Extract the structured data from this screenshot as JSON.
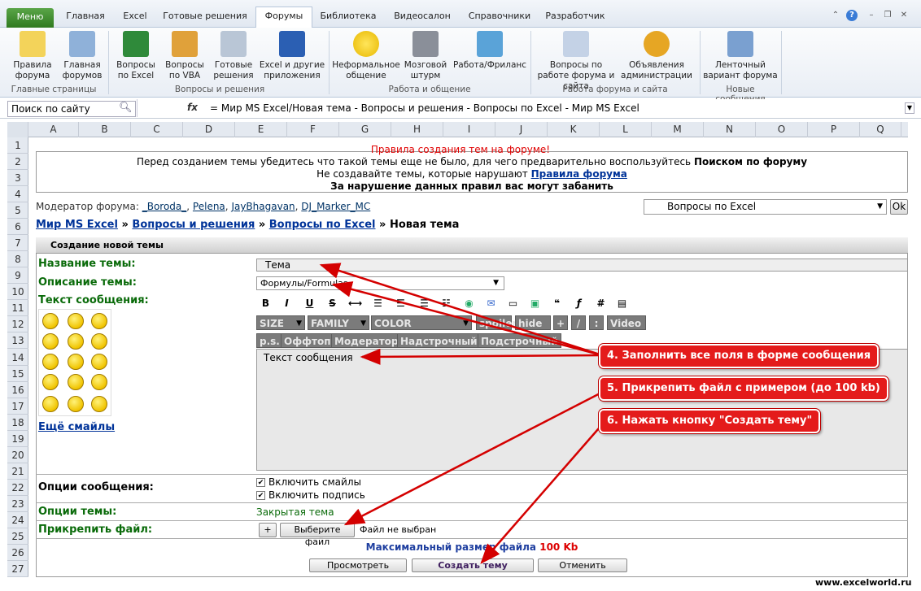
{
  "tabs": [
    "Меню",
    "Главная",
    "Excel",
    "Готовые решения",
    "Форумы",
    "Библиотека",
    "Видеосалон",
    "Справочники",
    "Разработчик"
  ],
  "ribbon": {
    "btn1": "Правила форума",
    "btn2": "Главная форумов",
    "grp1": "Главные страницы",
    "btn3": "Вопросы по Excel",
    "btn4": "Вопросы по VBA",
    "btn5": "Готовые решения",
    "btn6": "Excel и другие приложения",
    "grp2": "Вопросы и решения",
    "btn7": "Неформальное общение",
    "btn8": "Мозговой штурм",
    "btn9": "Работа/Фриланс",
    "grp3": "Работа и общение",
    "btn10": "Вопросы по работе форума и сайта",
    "btn11": "Объявления администрации",
    "grp4": "Работа форума и сайта",
    "btn12": "Ленточный вариант форума",
    "grp5": "Новые сообщения"
  },
  "formula_bar": {
    "namebox": "Поиск по сайту",
    "fx": "fx",
    "formula": "= Мир MS Excel/Новая тема - Вопросы и решения - Вопросы по Excel - Мир MS Excel"
  },
  "columns": [
    "A",
    "B",
    "C",
    "D",
    "E",
    "F",
    "G",
    "H",
    "I",
    "J",
    "K",
    "L",
    "M",
    "N",
    "O",
    "P",
    "Q"
  ],
  "rows": [
    "1",
    "2",
    "3",
    "4",
    "5",
    "6",
    "7",
    "8",
    "9",
    "10",
    "11",
    "12",
    "13",
    "14",
    "15",
    "16",
    "17",
    "18",
    "19",
    "20",
    "21",
    "22",
    "23",
    "24",
    "25",
    "26",
    "27"
  ],
  "rules": {
    "title": "Правила создания тем на форуме!",
    "line1a": "Перед созданием темы убедитесь что такой темы еще не было, для чего предварительно воспользуйтесь ",
    "line1b": "Поиском по форуму",
    "line2a": "Не создавайте темы, которые нарушают ",
    "line2b": "Правила форума",
    "line3": "За нарушение данных правил вас могут забанить"
  },
  "moderators": {
    "label": "Модератор форума:",
    "m1": "_Boroda_",
    "m2": "Pelena",
    "m3": "JayBhagavan",
    "m4": "DJ_Marker_MC"
  },
  "forum_select": {
    "value": "Вопросы по Excel",
    "ok": "Ok"
  },
  "breadcrumb": {
    "b1": "Мир MS Excel",
    "sep": "»",
    "b2": "Вопросы и решения",
    "b3": "Вопросы по Excel",
    "b4": "Новая тема"
  },
  "form": {
    "header": "Создание новой темы",
    "title_label": "Название темы:",
    "title_value": "Тема",
    "desc_label": "Описание темы:",
    "desc_value": "Формулы/Formulas",
    "text_label": "Текст сообщения:",
    "text_value": "Текст сообщения",
    "more_smiles": "Ещё смайлы",
    "opts_label": "Опции сообщения:",
    "opt1": "Включить смайлы",
    "opt2": "Включить подпись",
    "topic_label": "Опции темы:",
    "topic_value": "Закрытая тема",
    "attach_label": "Прикрепить файл:",
    "attach_plus": "+",
    "attach_btn": "Выберите файл",
    "attach_none": "Файл не выбран",
    "max_size": "Максимальный размер файла ",
    "max_size_val": "100 Kb",
    "preview": "Просмотреть",
    "create": "Создать тему",
    "cancel": "Отменить"
  },
  "toolbar": {
    "b": "B",
    "i": "I",
    "u": "U",
    "s": "S",
    "size": "SIZE",
    "family": "FAMILY",
    "color": "COLOR",
    "spoiler": "spoiler",
    "hide": "hide",
    "plus": "+",
    "slash": "/",
    "colon": ":",
    "video": "Video",
    "ps": "p.s.",
    "offtop": "Оффтоп",
    "moder": "Модератор",
    "sup": "Надстрочный",
    "sub": "Подстрочный"
  },
  "callouts": {
    "c4": "4. Заполнить все поля в форме сообщения",
    "c5": "5. Прикрепить файл с примером (до 100 kb)",
    "c6": "6. Нажать кнопку \"Создать тему\""
  },
  "watermark": "www.excelworld.ru"
}
